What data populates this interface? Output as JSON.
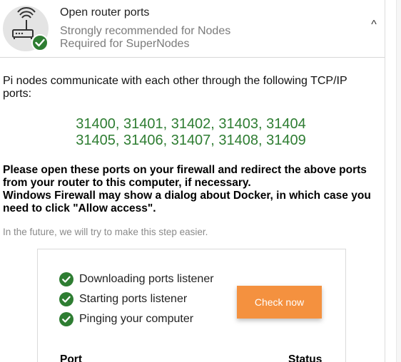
{
  "header": {
    "title": "Open router ports",
    "subtitle_1": "Strongly recommended for Nodes",
    "subtitle_2": "Required for SuperNodes",
    "collapse_glyph": "^",
    "icon": "router-wifi-icon",
    "status_icon": "check-badge-icon"
  },
  "content": {
    "intro": "Pi nodes communicate with each other through the following TCP/IP ports:",
    "ports_line_1": "31400, 31401, 31402, 31403, 31404",
    "ports_line_2": "31405, 31406, 31407, 31408, 31409",
    "instruction_1": "Please open these ports on your firewall and redirect the above ports from your router to this computer, if necessary.",
    "instruction_2": "Windows Firewall may show a dialog about Docker, in which case you need to click \"Allow access\".",
    "note": "In the future, we will try to make this step easier."
  },
  "checker": {
    "steps": [
      {
        "label": "Downloading ports listener"
      },
      {
        "label": "Starting ports listener"
      },
      {
        "label": "Pinging your computer"
      }
    ],
    "button_label": "Check now",
    "table_headers": {
      "port": "Port",
      "status": "Status"
    }
  },
  "colors": {
    "accent": "#f4913f",
    "success": "#2e7d32",
    "port_text": "#2e7d32"
  }
}
